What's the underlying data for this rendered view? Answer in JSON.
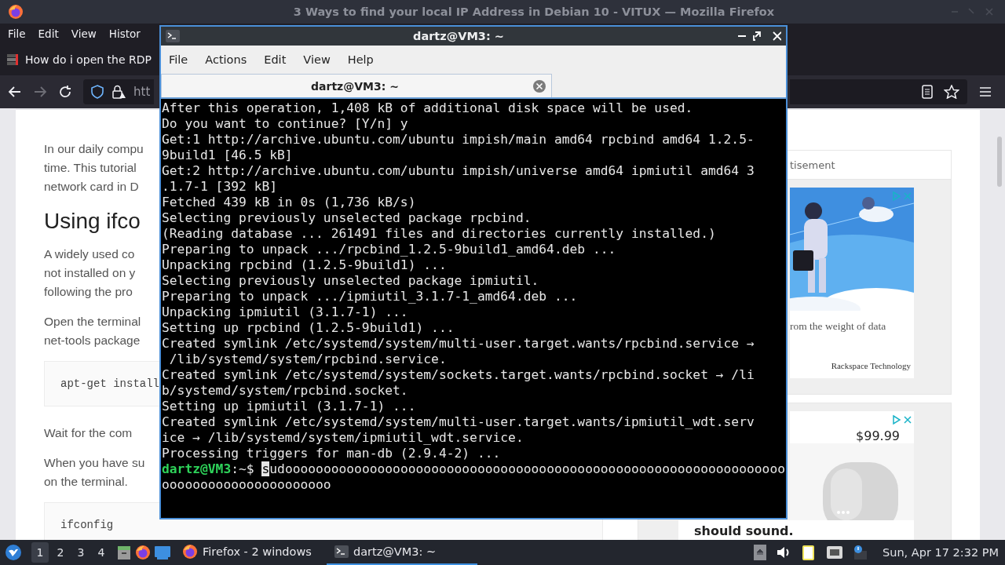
{
  "browser": {
    "title": "3 Ways to find your local IP Address in Debian 10 - VITUX — Mozilla Firefox",
    "menu": [
      "File",
      "Edit",
      "View",
      "Histor"
    ],
    "tab": {
      "title": "How do i open the RDP"
    },
    "url": "htt",
    "article": [
      {
        "kind": "paragraph",
        "lines": [
          "In our daily compu",
          "time. This tutorial",
          "network card in D"
        ]
      },
      {
        "kind": "heading",
        "text": "Using ifco"
      },
      {
        "kind": "paragraph",
        "lines": [
          "A widely used co",
          "not installed on y",
          "following the pro"
        ]
      },
      {
        "kind": "paragraph",
        "lines": [
          "Open the terminal",
          "net-tools package"
        ]
      },
      {
        "kind": "code",
        "text": "apt-get install"
      },
      {
        "kind": "paragraph",
        "lines": [
          "Wait for the com"
        ]
      },
      {
        "kind": "paragraph",
        "lines": [
          "When you have su",
          "on the terminal."
        ]
      },
      {
        "kind": "code",
        "text": "ifconfig"
      }
    ],
    "ads": [
      {
        "kind": "banner",
        "label": "tisement",
        "caption": "rom the weight of data",
        "sponsor": "Rackspace Technology"
      },
      {
        "kind": "product",
        "price": "$99.99",
        "tagline": "should sound."
      }
    ]
  },
  "terminal": {
    "title": "dartz@VM3: ~",
    "menu": [
      "File",
      "Actions",
      "Edit",
      "View",
      "Help"
    ],
    "tab": "dartz@VM3: ~",
    "lines": [
      "After this operation, 1,408 kB of additional disk space will be used.",
      "Do you want to continue? [Y/n] y",
      "Get:1 http://archive.ubuntu.com/ubuntu impish/main amd64 rpcbind amd64 1.2.5-",
      "9build1 [46.5 kB]",
      "Get:2 http://archive.ubuntu.com/ubuntu impish/universe amd64 ipmiutil amd64 3",
      ".1.7-1 [392 kB]",
      "Fetched 439 kB in 0s (1,736 kB/s)",
      "Selecting previously unselected package rpcbind.",
      "(Reading database ... 261491 files and directories currently installed.)",
      "Preparing to unpack .../rpcbind_1.2.5-9build1_amd64.deb ...",
      "Unpacking rpcbind (1.2.5-9build1) ...",
      "Selecting previously unselected package ipmiutil.",
      "Preparing to unpack .../ipmiutil_3.1.7-1_amd64.deb ...",
      "Unpacking ipmiutil (3.1.7-1) ...",
      "Setting up rpcbind (1.2.5-9build1) ...",
      "Created symlink /etc/systemd/system/multi-user.target.wants/rpcbind.service →",
      " /lib/systemd/system/rpcbind.service.",
      "Created symlink /etc/systemd/system/sockets.target.wants/rpcbind.socket → /li",
      "b/systemd/system/rpcbind.socket.",
      "Setting up ipmiutil (3.1.7-1) ...",
      "Created symlink /etc/systemd/system/multi-user.target.wants/ipmiutil_wdt.serv",
      "ice → /lib/systemd/system/ipmiutil_wdt.service.",
      "Processing triggers for man-db (2.9.4-2) ..."
    ],
    "prompt": {
      "user": "dartz@VM3",
      "path": ":~$",
      "cursor": "s",
      "input": "udooooooooooooooooooooooooooooooooooooooooooooooooooooooooooooooooo",
      "wrapped": "oooooooooooooooooooooo"
    }
  },
  "taskbar": {
    "workspaces": [
      {
        "label": "1",
        "selected": true
      },
      {
        "label": "2",
        "selected": false
      },
      {
        "label": "3",
        "selected": false
      },
      {
        "label": "4",
        "selected": false
      }
    ],
    "tasks": [
      {
        "kind": "firefox",
        "label": "Firefox - 2 windows",
        "selected": false
      },
      {
        "kind": "terminal",
        "label": "dartz@VM3: ~",
        "selected": true
      }
    ],
    "clock": "Sun, Apr 17 2:32 PM"
  }
}
